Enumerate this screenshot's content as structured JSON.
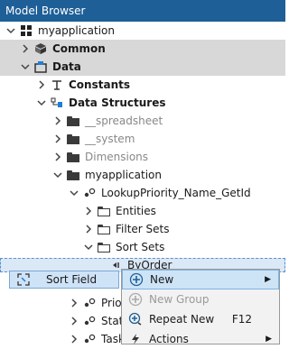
{
  "window": {
    "title": "Model Browser"
  },
  "tree": {
    "root": "myapplication",
    "common": "Common",
    "data": "Data",
    "constants": "Constants",
    "data_structures": "Data Structures",
    "spreadsheet": "__spreadsheet",
    "system": "__system",
    "dimensions": "Dimensions",
    "myapplication_folder": "myapplication",
    "lookup": "LookupPriority_Name_GetId",
    "entities": "Entities",
    "filter_sets": "Filter Sets",
    "sort_sets": "Sort Sets",
    "byorder": "ByOrder",
    "priori": "Priori",
    "status": "Status",
    "task": "Task"
  },
  "drag_item": {
    "label": "Sort Field"
  },
  "context_menu": {
    "items": [
      {
        "label": "New",
        "shortcut": "",
        "submenu": true,
        "disabled": false
      },
      {
        "label": "New Group",
        "shortcut": "",
        "submenu": false,
        "disabled": true
      },
      {
        "label": "Repeat New",
        "shortcut": "F12",
        "submenu": false,
        "disabled": false
      },
      {
        "label": "Actions",
        "shortcut": "",
        "submenu": true,
        "disabled": false
      }
    ]
  }
}
